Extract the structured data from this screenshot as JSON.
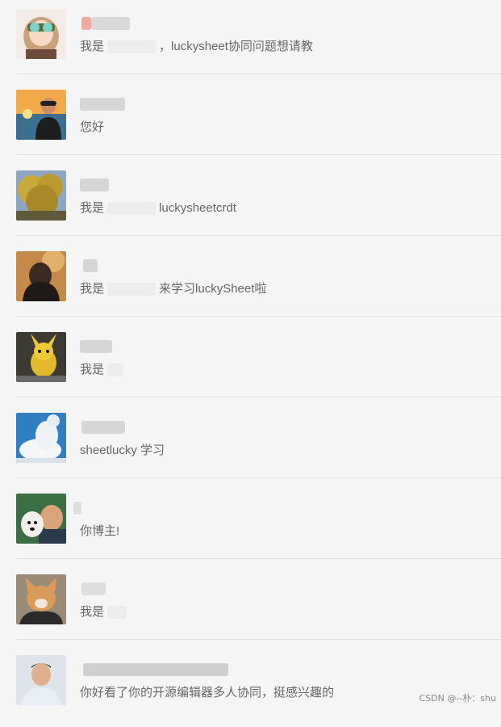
{
  "conversations": [
    {
      "message_prefix": "我是",
      "message_suffix": "，luckysheet协同问题想请教",
      "avatar": "anime-girl-avatar"
    },
    {
      "message_prefix": "",
      "message_suffix": "您好",
      "avatar": "sunset-person-avatar"
    },
    {
      "message_prefix": "我是",
      "message_suffix": "luckysheetcrdt",
      "avatar": "tree-avatar"
    },
    {
      "message_prefix": "我是",
      "message_suffix": "来学习luckySheet啦",
      "avatar": "dark-person-avatar"
    },
    {
      "message_prefix": "我是",
      "message_suffix": "",
      "avatar": "pikachu-avatar"
    },
    {
      "message_prefix": "",
      "message_suffix": "sheetlucky 学习",
      "avatar": "cloud-avatar"
    },
    {
      "message_prefix": "",
      "message_suffix": "你博主!",
      "avatar": "dog-person-avatar"
    },
    {
      "message_prefix": "我是",
      "message_suffix": "",
      "avatar": "corgi-avatar"
    },
    {
      "message_prefix": "",
      "message_suffix": "你好看了你的开源编辑器多人协同，挺感兴趣的",
      "avatar": "man-avatar"
    }
  ],
  "watermark": "CSDN @--朴：shu"
}
